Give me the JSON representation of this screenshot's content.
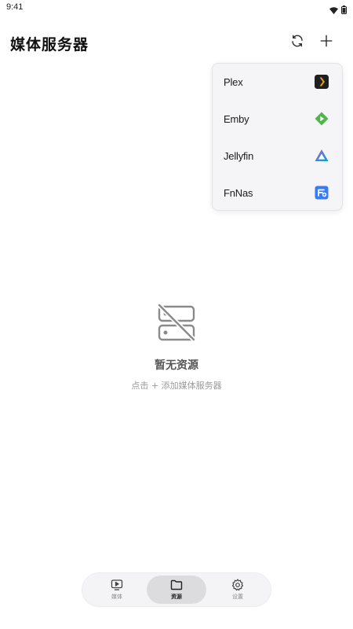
{
  "status_bar": {
    "time": "9:41",
    "icons": [
      "wifi-icon",
      "battery-icon"
    ]
  },
  "header": {
    "title": "媒体服务器",
    "actions": [
      {
        "name": "refresh",
        "icon": "refresh-icon"
      },
      {
        "name": "add",
        "icon": "plus-icon"
      }
    ]
  },
  "dropdown": {
    "items": [
      {
        "label": "Plex",
        "icon": "plex-icon",
        "color": "#e5a00d"
      },
      {
        "label": "Emby",
        "icon": "emby-icon",
        "color": "#52b54b"
      },
      {
        "label": "Jellyfin",
        "icon": "jellyfin-icon",
        "color": "#aa5cc3"
      },
      {
        "label": "FnNas",
        "icon": "fnnas-icon",
        "color": "#3a7bf5"
      }
    ]
  },
  "empty_state": {
    "icon": "server-off-icon",
    "title": "暂无资源",
    "hint": "点击 + 添加媒体服务器"
  },
  "bottom_nav": {
    "items": [
      {
        "label": "媒体",
        "icon": "media-icon",
        "active": false
      },
      {
        "label": "资源",
        "icon": "folder-icon",
        "active": true
      },
      {
        "label": "设置",
        "icon": "settings-icon",
        "active": false
      }
    ]
  }
}
